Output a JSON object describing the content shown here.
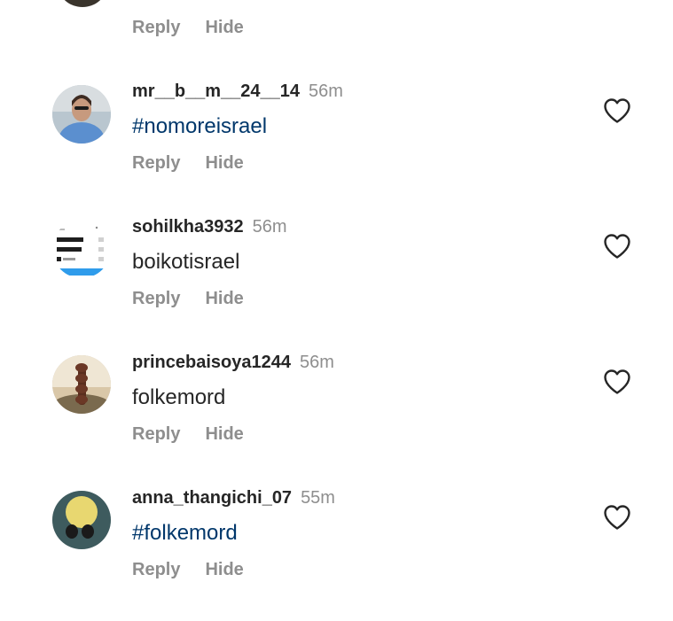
{
  "top_comment": {
    "reply_label": "Reply",
    "hide_label": "Hide"
  },
  "comments": [
    {
      "username": "mr__b__m__24__14",
      "time": "56m",
      "text": "#nomoreisrael",
      "reply_label": "Reply",
      "hide_label": "Hide",
      "is_hashtag": true
    },
    {
      "username": "sohilkha3932",
      "time": "56m",
      "text": "boikotisrael",
      "reply_label": "Reply",
      "hide_label": "Hide",
      "is_hashtag": false
    },
    {
      "username": "princebaisoya1244",
      "time": "56m",
      "text": "folkemord",
      "reply_label": "Reply",
      "hide_label": "Hide",
      "is_hashtag": false
    },
    {
      "username": "anna_thangichi_07",
      "time": "55m",
      "text": "#folkemord",
      "reply_label": "Reply",
      "hide_label": "Hide",
      "is_hashtag": true
    }
  ],
  "icons": {
    "like": "heart-outline-icon"
  },
  "colors": {
    "username": "#262626",
    "meta": "#8e8e8e",
    "hashtag": "#00376b",
    "background": "#ffffff"
  }
}
